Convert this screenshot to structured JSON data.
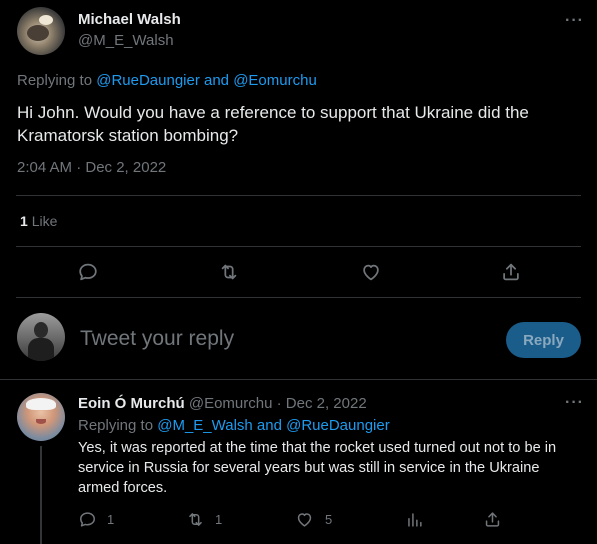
{
  "main_tweet": {
    "author_name": "Michael Walsh",
    "author_handle": "@M_E_Walsh",
    "more_label": "···",
    "replying_prefix": "Replying to",
    "replying_mentions": "@RueDaungier and @Eomurchu",
    "text": "Hi John.  Would you have a reference to support that Ukraine did the Kramatorsk station bombing?",
    "timestamp": "2:04 AM · Dec 2, 2022",
    "likes_count": "1",
    "likes_label": "Like",
    "actions": [
      "reply-icon",
      "retweet-icon",
      "like-icon",
      "share-icon"
    ]
  },
  "composer": {
    "placeholder": "Tweet your reply",
    "reply_button": "Reply"
  },
  "reply_tweet": {
    "author_name": "Eoin Ó Murchú",
    "author_handle": "@Eomurchu",
    "date": "· Dec 2, 2022",
    "more_label": "···",
    "replying_prefix": "Replying to",
    "replying_mentions": "@M_E_Walsh and @RueDaungier",
    "text": "Yes, it was reported at the time that the rocket used turned out not to be in service in Russia for several years but was still in service in the Ukraine armed forces.",
    "reply_count": "1",
    "retweet_count": "1",
    "like_count": "5"
  },
  "colors": {
    "background": "#000000",
    "text": "#e7e9ea",
    "muted": "#71767b",
    "link": "#1d9bf0",
    "divider": "#2f3336",
    "reply_button_bg": "#1a5c8a"
  }
}
